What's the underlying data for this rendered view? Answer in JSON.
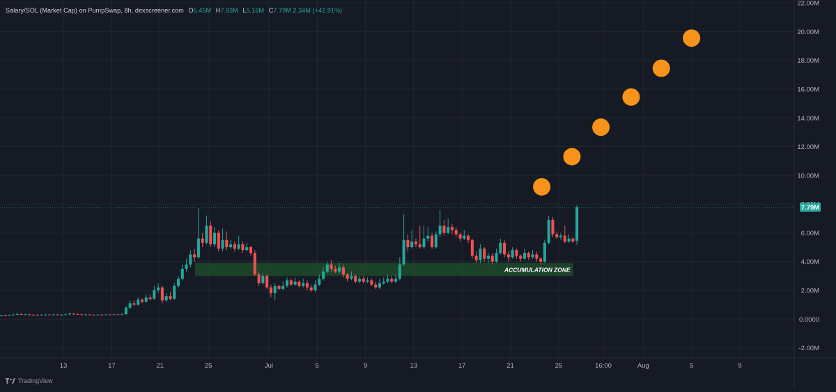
{
  "header": {
    "title": "Salary/SOL (Market Cap) on PumpSwap, 8h, dexscreener.com",
    "open_label": "O",
    "open": "5.45M",
    "high_label": "H",
    "high": "7.93M",
    "low_label": "L",
    "low": "5.16M",
    "close_label": "C",
    "close": "7.79M",
    "change": "2.34M (+42.91%)"
  },
  "watermark": "TradingView",
  "colors": {
    "background": "#161a25",
    "up": "#26a69a",
    "down": "#ef5350",
    "zone": "#1f4a2c",
    "dots": "#f7931a",
    "price_tag": "#26a69a"
  },
  "chart_data": {
    "type": "candlestick",
    "ylim": [
      -2.7,
      22.2
    ],
    "yticks": [
      "22.00M",
      "20.00M",
      "18.00M",
      "16.00M",
      "14.00M",
      "12.00M",
      "10.00M",
      "8.00M",
      "6.00M",
      "4.00M",
      "2.00M",
      "0.0000",
      "-2.00M"
    ],
    "xticks": [
      {
        "label": "13",
        "x": 4
      },
      {
        "label": "17",
        "x": 8
      },
      {
        "label": "21",
        "x": 12
      },
      {
        "label": "25",
        "x": 16
      },
      {
        "label": "Jul",
        "x": 21
      },
      {
        "label": "5",
        "x": 25
      },
      {
        "label": "9",
        "x": 29
      },
      {
        "label": "13",
        "x": 33
      },
      {
        "label": "17",
        "x": 37
      },
      {
        "label": "21",
        "x": 41
      },
      {
        "label": "25",
        "x": 45
      },
      {
        "label": "16:00",
        "x": 48.7
      },
      {
        "label": "Aug",
        "x": 52
      },
      {
        "label": "5",
        "x": 56
      },
      {
        "label": "9",
        "x": 60
      }
    ],
    "xlim": [
      -1.25,
      64.5
    ],
    "candles": [
      [
        0.23,
        0.25,
        0.3,
        0.2
      ],
      [
        0.25,
        0.24,
        0.3,
        0.2
      ],
      [
        0.24,
        0.28,
        0.32,
        0.22
      ],
      [
        0.28,
        0.3,
        0.4,
        0.25
      ],
      [
        0.3,
        0.35,
        0.45,
        0.28
      ],
      [
        0.35,
        0.31,
        0.4,
        0.28
      ],
      [
        0.31,
        0.33,
        0.38,
        0.27
      ],
      [
        0.33,
        0.3,
        0.36,
        0.25
      ],
      [
        0.3,
        0.28,
        0.34,
        0.24
      ],
      [
        0.28,
        0.27,
        0.33,
        0.23
      ],
      [
        0.27,
        0.29,
        0.35,
        0.24
      ],
      [
        0.29,
        0.31,
        0.37,
        0.26
      ],
      [
        0.31,
        0.3,
        0.36,
        0.26
      ],
      [
        0.3,
        0.32,
        0.38,
        0.27
      ],
      [
        0.32,
        0.28,
        0.36,
        0.25
      ],
      [
        0.28,
        0.3,
        0.35,
        0.25
      ],
      [
        0.3,
        0.33,
        0.38,
        0.27
      ],
      [
        0.33,
        0.38,
        0.45,
        0.3
      ],
      [
        0.38,
        0.35,
        0.42,
        0.3
      ],
      [
        0.35,
        0.33,
        0.4,
        0.3
      ],
      [
        0.33,
        0.3,
        0.38,
        0.27
      ],
      [
        0.3,
        0.32,
        0.37,
        0.27
      ],
      [
        0.32,
        0.3,
        0.36,
        0.27
      ],
      [
        0.3,
        0.29,
        0.34,
        0.26
      ],
      [
        0.29,
        0.31,
        0.35,
        0.26
      ],
      [
        0.31,
        0.3,
        0.35,
        0.27
      ],
      [
        0.3,
        0.32,
        0.36,
        0.28
      ],
      [
        0.32,
        0.31,
        0.37,
        0.28
      ],
      [
        0.31,
        0.33,
        0.37,
        0.28
      ],
      [
        0.33,
        0.32,
        0.38,
        0.29
      ],
      [
        0.32,
        0.34,
        0.4,
        0.3
      ],
      [
        0.34,
        0.8,
        0.9,
        0.3
      ],
      [
        0.8,
        1.1,
        1.3,
        0.7
      ],
      [
        1.1,
        1.0,
        1.3,
        0.9
      ],
      [
        1.0,
        1.35,
        1.5,
        0.95
      ],
      [
        1.35,
        1.2,
        1.45,
        1.1
      ],
      [
        1.2,
        1.5,
        1.7,
        1.15
      ],
      [
        1.5,
        1.4,
        1.7,
        1.3
      ],
      [
        1.4,
        2.0,
        2.3,
        1.35
      ],
      [
        2.0,
        2.2,
        2.5,
        1.8
      ],
      [
        2.2,
        1.3,
        2.3,
        1.1
      ],
      [
        1.3,
        1.6,
        1.8,
        1.2
      ],
      [
        1.6,
        1.4,
        1.9,
        1.3
      ],
      [
        1.4,
        2.3,
        2.5,
        1.35
      ],
      [
        2.3,
        2.8,
        3.0,
        2.2
      ],
      [
        2.8,
        3.5,
        3.8,
        2.7
      ],
      [
        3.5,
        3.8,
        4.2,
        3.3
      ],
      [
        3.8,
        4.5,
        4.8,
        3.6
      ],
      [
        4.5,
        4.3,
        4.9,
        4.0
      ],
      [
        4.3,
        5.6,
        7.7,
        4.2
      ],
      [
        5.6,
        5.3,
        6.0,
        5.0
      ],
      [
        5.3,
        6.5,
        7.2,
        5.2
      ],
      [
        6.5,
        5.2,
        6.8,
        5.0
      ],
      [
        5.2,
        6.0,
        6.4,
        5.0
      ],
      [
        6.0,
        4.9,
        6.2,
        4.7
      ],
      [
        4.9,
        5.5,
        6.3,
        4.7
      ],
      [
        5.5,
        5.0,
        6.1,
        4.8
      ],
      [
        5.0,
        5.2,
        5.5,
        4.9
      ],
      [
        5.2,
        4.9,
        5.4,
        4.7
      ],
      [
        4.9,
        5.2,
        5.8,
        4.8
      ],
      [
        5.2,
        4.8,
        5.4,
        4.6
      ],
      [
        4.8,
        5.0,
        5.3,
        4.7
      ],
      [
        5.0,
        4.6,
        5.1,
        4.4
      ],
      [
        4.6,
        3.1,
        4.8,
        3.0
      ],
      [
        3.1,
        2.5,
        3.3,
        2.3
      ],
      [
        2.5,
        3.0,
        3.2,
        2.4
      ],
      [
        3.0,
        2.2,
        3.1,
        2.1
      ],
      [
        2.2,
        1.8,
        2.4,
        1.5
      ],
      [
        1.8,
        2.3,
        2.5,
        1.3
      ],
      [
        2.3,
        2.1,
        2.4,
        2.0
      ],
      [
        2.1,
        2.3,
        2.6,
        2.0
      ],
      [
        2.3,
        2.7,
        2.9,
        2.2
      ],
      [
        2.7,
        2.4,
        2.8,
        2.3
      ],
      [
        2.4,
        2.6,
        2.9,
        2.3
      ],
      [
        2.6,
        2.3,
        2.7,
        2.2
      ],
      [
        2.3,
        2.5,
        2.8,
        2.2
      ],
      [
        2.5,
        2.2,
        2.7,
        2.0
      ],
      [
        2.2,
        2.0,
        2.4,
        1.9
      ],
      [
        2.0,
        2.4,
        2.7,
        1.9
      ],
      [
        2.4,
        2.8,
        3.1,
        2.3
      ],
      [
        2.8,
        3.3,
        3.6,
        2.7
      ],
      [
        3.3,
        3.8,
        4.0,
        3.2
      ],
      [
        3.8,
        3.5,
        4.1,
        3.3
      ],
      [
        3.5,
        3.3,
        3.7,
        3.2
      ],
      [
        3.3,
        3.6,
        3.9,
        3.2
      ],
      [
        3.6,
        3.1,
        3.8,
        2.9
      ],
      [
        3.1,
        2.8,
        3.2,
        2.6
      ],
      [
        2.8,
        3.0,
        3.3,
        2.7
      ],
      [
        3.0,
        2.6,
        3.1,
        2.5
      ],
      [
        2.6,
        2.8,
        3.0,
        2.5
      ],
      [
        2.8,
        2.6,
        3.0,
        2.5
      ],
      [
        2.6,
        2.7,
        2.9,
        2.5
      ],
      [
        2.7,
        2.4,
        2.8,
        2.3
      ],
      [
        2.4,
        2.2,
        2.6,
        2.1
      ],
      [
        2.2,
        2.5,
        2.8,
        2.1
      ],
      [
        2.5,
        2.6,
        2.9,
        2.4
      ],
      [
        2.6,
        2.8,
        3.1,
        2.5
      ],
      [
        2.8,
        2.6,
        3.0,
        2.5
      ],
      [
        2.6,
        2.8,
        3.1,
        2.5
      ],
      [
        2.8,
        3.8,
        4.3,
        2.7
      ],
      [
        3.8,
        5.5,
        7.3,
        3.7
      ],
      [
        5.5,
        5.0,
        5.9,
        4.7
      ],
      [
        5.0,
        5.4,
        6.2,
        4.9
      ],
      [
        5.4,
        5.2,
        5.6,
        5.0
      ],
      [
        5.2,
        5.0,
        6.5,
        4.9
      ],
      [
        5.0,
        5.6,
        6.5,
        4.9
      ],
      [
        5.6,
        5.8,
        6.4,
        5.4
      ],
      [
        5.8,
        5.0,
        6.0,
        4.9
      ],
      [
        5.0,
        5.9,
        6.1,
        4.9
      ],
      [
        5.9,
        6.5,
        7.6,
        5.7
      ],
      [
        6.5,
        6.0,
        6.9,
        5.8
      ],
      [
        6.0,
        6.4,
        7.0,
        5.9
      ],
      [
        6.4,
        6.2,
        6.6,
        5.9
      ],
      [
        6.2,
        5.9,
        6.4,
        5.7
      ],
      [
        5.9,
        5.6,
        6.0,
        5.4
      ],
      [
        5.6,
        5.8,
        6.2,
        5.5
      ],
      [
        5.8,
        5.5,
        5.9,
        5.3
      ],
      [
        5.5,
        4.4,
        5.6,
        4.2
      ],
      [
        4.4,
        4.1,
        4.7,
        3.9
      ],
      [
        4.1,
        4.9,
        5.2,
        3.9
      ],
      [
        4.9,
        4.2,
        5.0,
        4.0
      ],
      [
        4.2,
        4.4,
        4.6,
        3.9
      ],
      [
        4.4,
        4.0,
        4.6,
        3.8
      ],
      [
        4.0,
        4.6,
        4.9,
        3.9
      ],
      [
        4.6,
        5.3,
        5.6,
        4.5
      ],
      [
        5.3,
        4.5,
        5.5,
        4.3
      ],
      [
        4.5,
        4.3,
        4.7,
        4.0
      ],
      [
        4.3,
        4.8,
        5.0,
        4.2
      ],
      [
        4.8,
        4.4,
        4.9,
        4.2
      ],
      [
        4.4,
        4.2,
        4.5,
        4.0
      ],
      [
        4.2,
        4.6,
        4.9,
        4.1
      ],
      [
        4.6,
        4.3,
        4.7,
        4.1
      ],
      [
        4.3,
        4.5,
        4.8,
        4.2
      ],
      [
        4.5,
        4.2,
        4.7,
        4.0
      ],
      [
        4.2,
        4.0,
        4.3,
        3.8
      ],
      [
        4.0,
        5.3,
        5.5,
        3.9
      ],
      [
        5.3,
        6.9,
        7.2,
        5.2
      ],
      [
        6.9,
        5.9,
        7.1,
        5.7
      ],
      [
        5.9,
        5.7,
        6.1,
        5.6
      ],
      [
        5.7,
        5.8,
        6.0,
        5.5
      ],
      [
        5.8,
        5.4,
        6.5,
        5.3
      ],
      [
        5.4,
        5.6,
        5.9,
        5.3
      ],
      [
        5.6,
        5.4,
        5.7,
        5.3
      ],
      [
        5.45,
        7.79,
        7.93,
        5.16
      ]
    ],
    "candle_start_x": -1.15,
    "candle_step": 0.3333,
    "accumulation_zone": {
      "label": "ACCUMULATION ZONE",
      "x0": 14.9,
      "x1": 46.2,
      "y0": 3.0,
      "y1": 3.9
    },
    "projection_dots": [
      {
        "x": 43.6,
        "y": 9.2
      },
      {
        "x": 46.1,
        "y": 11.3
      },
      {
        "x": 48.5,
        "y": 13.35
      },
      {
        "x": 51.0,
        "y": 15.45
      },
      {
        "x": 53.5,
        "y": 17.45
      },
      {
        "x": 56.0,
        "y": 19.55
      }
    ],
    "last_price": 7.79,
    "last_price_label": "7.79M",
    "grid": true
  }
}
